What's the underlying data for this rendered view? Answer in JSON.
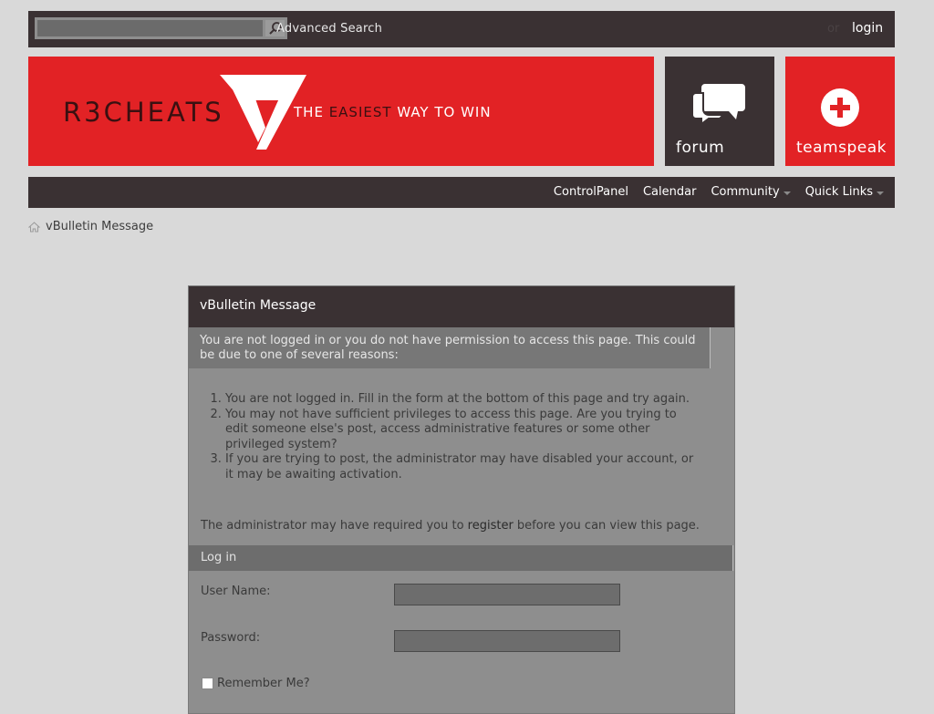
{
  "topbar": {
    "search_placeholder": "",
    "advanced_search": "Advanced Search",
    "or": "or",
    "login": "login"
  },
  "header": {
    "logo": "R3CHEATS",
    "tagline_prefix": "THE ",
    "tagline_highlight": "EASIEST",
    "tagline_suffix": " WAY TO WIN",
    "tiles": [
      {
        "label": "forum",
        "icon": "chat-bubbles-icon"
      },
      {
        "label": "teamspeak",
        "icon": "plus-circle-icon"
      }
    ],
    "colors": {
      "brand_red": "#e22225",
      "dark": "#3a3133"
    }
  },
  "nav": {
    "items": [
      {
        "label": "ControlPanel",
        "dropdown": false
      },
      {
        "label": "Calendar",
        "dropdown": false
      },
      {
        "label": "Community",
        "dropdown": true
      },
      {
        "label": "Quick Links",
        "dropdown": true
      }
    ]
  },
  "breadcrumb": {
    "current": "vBulletin Message"
  },
  "message": {
    "title": "vBulletin Message",
    "notice": "You are not logged in or you do not have permission to access this page. This could be due to one of several reasons:",
    "reasons": [
      "You are not logged in. Fill in the form at the bottom of this page and try again.",
      "You may not have sufficient privileges to access this page. Are you trying to edit someone else's post, access administrative features or some other privileged system?",
      "If you are trying to post, the administrator may have disabled your account, or it may be awaiting activation."
    ],
    "admin_prefix": "The administrator may have required you to ",
    "admin_link": "register",
    "admin_suffix": " before you can view this page."
  },
  "login_form": {
    "title": "Log in",
    "username_label": "User Name:",
    "username_value": "",
    "password_label": "Password:",
    "password_value": "",
    "remember_label": "Remember Me?"
  }
}
